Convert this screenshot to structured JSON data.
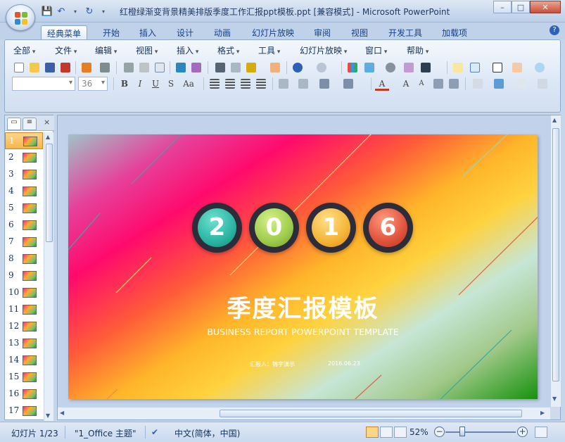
{
  "window": {
    "title": "红橙绿渐变背景精美排版季度工作汇报ppt模板.ppt [兼容模式] - Microsoft PowerPoint",
    "minimize": "–",
    "maximize": "□",
    "close": "✕"
  },
  "qat_icons": [
    "save-icon",
    "undo-icon",
    "redo-icon",
    "customize-qat-icon"
  ],
  "ribbon_tabs": [
    "经典菜单",
    "开始",
    "插入",
    "设计",
    "动画",
    "幻灯片放映",
    "审阅",
    "视图",
    "开发工具",
    "加载项"
  ],
  "active_tab": "经典菜单",
  "help": "?",
  "menus": [
    "全部",
    "文件",
    "编辑",
    "视图",
    "插入",
    "格式",
    "工具",
    "幻灯片放映",
    "窗口",
    "帮助"
  ],
  "font_name": "",
  "font_size": "36",
  "format_buttons": [
    "B",
    "I",
    "U",
    "S",
    "Aa"
  ],
  "panel": {
    "selected_slide": 1,
    "slide_numbers": [
      "1",
      "2",
      "3",
      "4",
      "5",
      "6",
      "7",
      "8",
      "9",
      "10",
      "11",
      "12",
      "13",
      "14",
      "15",
      "16",
      "17"
    ],
    "close": "×"
  },
  "slide": {
    "digits": [
      "2",
      "0",
      "1",
      "6"
    ],
    "digit_colors": [
      "#2bb5a3",
      "#9fcc4c",
      "#f6b437",
      "#e0533a"
    ],
    "title": "季度汇报模板",
    "subtitle": "BUSINESS REPORT POWERPOINT TEMPLATE",
    "presenter": "汇报人：锦宇演示",
    "date": "2016.06.23"
  },
  "status": {
    "slide_info": "幻灯片 1/23",
    "theme": "\"1_Office 主题\"",
    "language": "中文(简体，中国)",
    "zoom": "52%",
    "zoom_level": 0.52
  }
}
